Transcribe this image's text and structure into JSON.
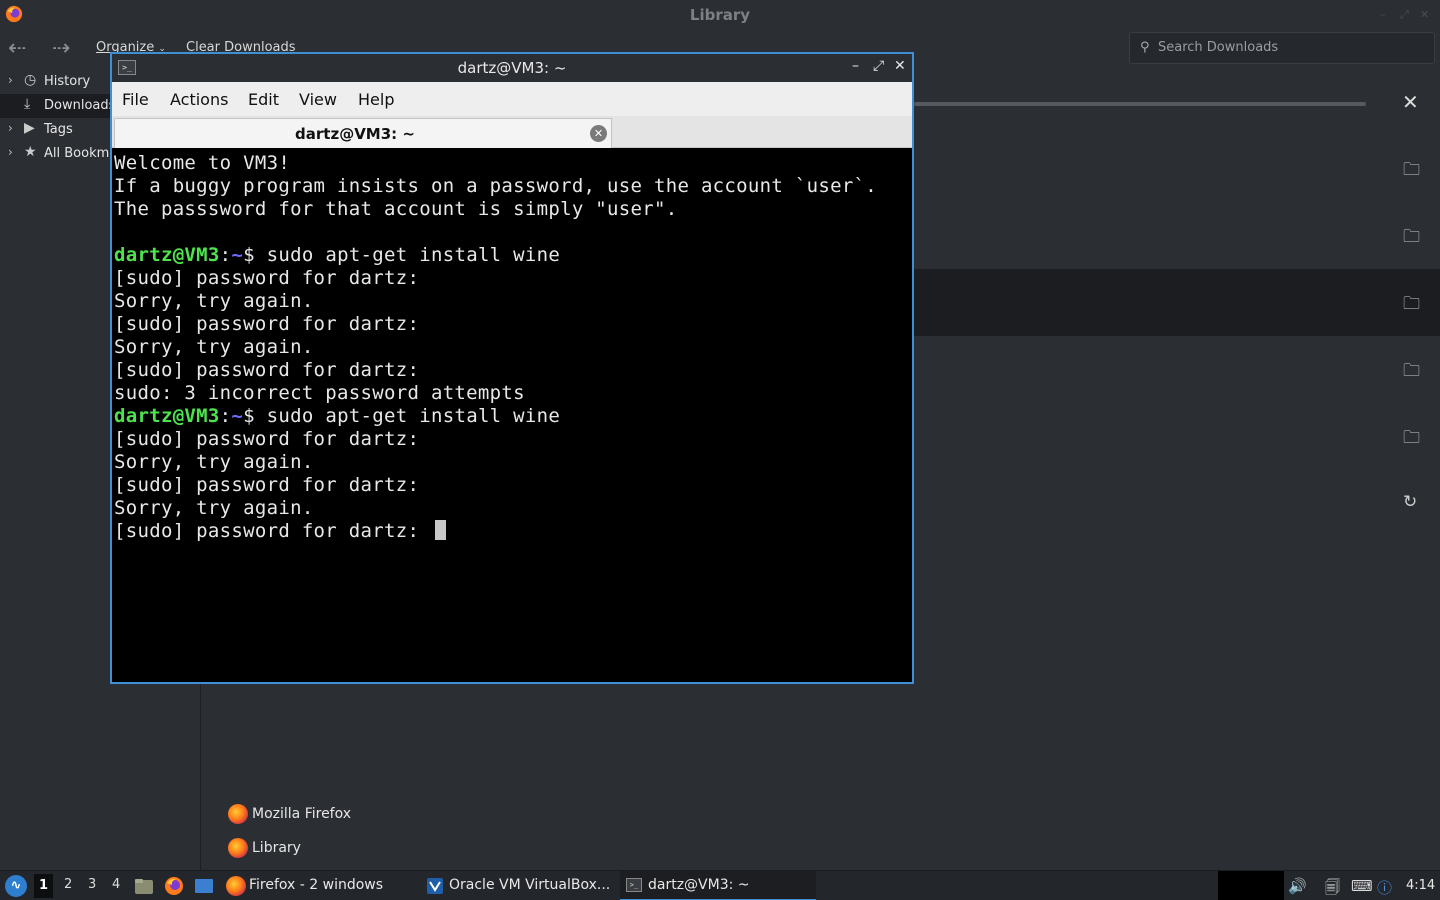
{
  "library": {
    "title": "Library",
    "toolbar": {
      "organize": "Organize",
      "clear_downloads": "Clear Downloads"
    },
    "search": {
      "placeholder": "Search Downloads",
      "value": ""
    },
    "sidebar": {
      "items": [
        {
          "label": "History",
          "icon": "clock-icon",
          "expandable": true
        },
        {
          "label": "Downloads",
          "icon": "download-icon",
          "expandable": false,
          "selected": true
        },
        {
          "label": "Tags",
          "icon": "tag-icon",
          "expandable": true
        },
        {
          "label": "All Bookmarks",
          "icon": "star-icon",
          "expandable": true
        }
      ]
    },
    "downloads": {
      "rows": [
        {
          "icon": "folder-icon"
        },
        {
          "icon": "folder-icon"
        },
        {
          "icon": "folder-icon",
          "selected": true
        },
        {
          "icon": "folder-icon"
        },
        {
          "icon": "folder-icon"
        },
        {
          "icon": "retry-icon"
        }
      ]
    }
  },
  "terminal": {
    "title": "dartz@VM3: ~",
    "menu": [
      "File",
      "Actions",
      "Edit",
      "View",
      "Help"
    ],
    "tab_label": "dartz@VM3: ~",
    "prompt": {
      "user": "dartz@VM3",
      "colon": ":",
      "path": "~",
      "dollar": "$ "
    },
    "lines": [
      {
        "type": "text",
        "text": "Welcome to VM3!"
      },
      {
        "type": "text",
        "text": "If a buggy program insists on a password, use the account `user`."
      },
      {
        "type": "text",
        "text": "The passsword for that account is simply \"user\"."
      },
      {
        "type": "text",
        "text": ""
      },
      {
        "type": "prompt",
        "text": "sudo apt-get install wine"
      },
      {
        "type": "text",
        "text": "[sudo] password for dartz:"
      },
      {
        "type": "text",
        "text": "Sorry, try again."
      },
      {
        "type": "text",
        "text": "[sudo] password for dartz:"
      },
      {
        "type": "text",
        "text": "Sorry, try again."
      },
      {
        "type": "text",
        "text": "[sudo] password for dartz:"
      },
      {
        "type": "text",
        "text": "sudo: 3 incorrect password attempts"
      },
      {
        "type": "prompt",
        "text": "sudo apt-get install wine"
      },
      {
        "type": "text",
        "text": "[sudo] password for dartz:"
      },
      {
        "type": "text",
        "text": "Sorry, try again."
      },
      {
        "type": "text",
        "text": "[sudo] password for dartz:"
      },
      {
        "type": "text",
        "text": "Sorry, try again."
      },
      {
        "type": "text",
        "text": "[sudo] password for dartz: ",
        "cursor": true
      }
    ]
  },
  "popup": {
    "items": [
      {
        "label": "Mozilla Firefox",
        "icon": "firefox-icon"
      },
      {
        "label": "Library",
        "icon": "firefox-icon"
      }
    ]
  },
  "taskbar": {
    "workspaces": [
      "1",
      "2",
      "3",
      "4"
    ],
    "active_workspace": "1",
    "tasks": [
      {
        "label": "Firefox - 2 windows",
        "icon": "firefox-icon"
      },
      {
        "label": "Oracle VM VirtualBox...",
        "icon": "virtualbox-icon"
      },
      {
        "label": "dartz@VM3: ~",
        "icon": "terminal-icon",
        "active": true
      }
    ],
    "clock": "4:14"
  },
  "colors": {
    "accent": "#3e8fd6",
    "prompt_user": "#4ee24e",
    "prompt_path": "#6b6bff",
    "terminal_bg": "#000000"
  }
}
